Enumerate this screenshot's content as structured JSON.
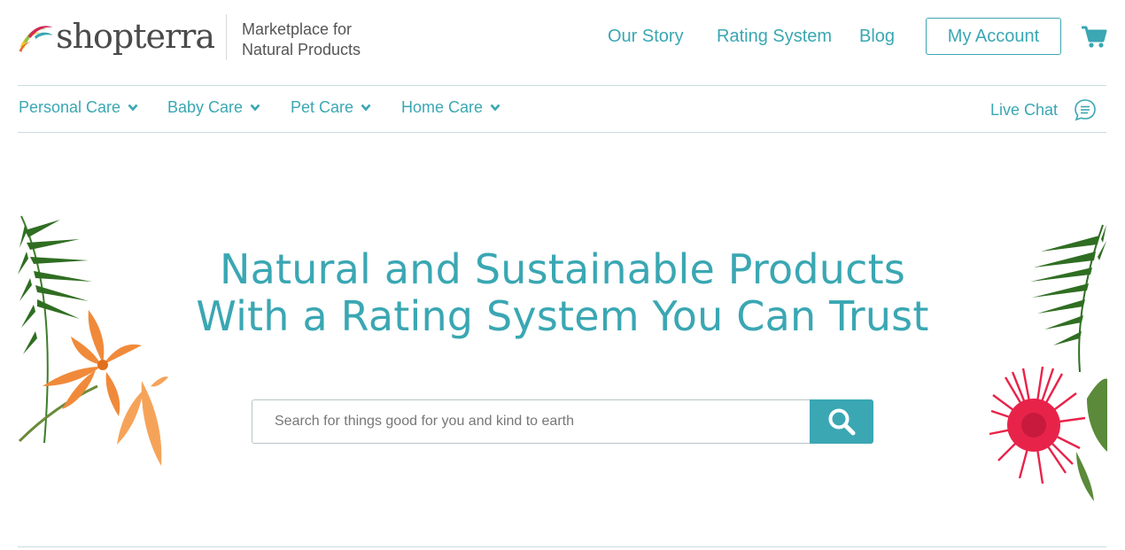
{
  "brand": {
    "name": "shopterra",
    "tagline_line1": "Marketplace for",
    "tagline_line2": "Natural Products"
  },
  "top_nav": {
    "our_story": "Our Story",
    "rating_system": "Rating System",
    "blog": "Blog",
    "my_account": "My Account",
    "cart_icon": "shopping-cart-icon"
  },
  "categories": [
    {
      "label": "Personal Care",
      "icon": "chevron-down-icon"
    },
    {
      "label": "Baby Care",
      "icon": "chevron-down-icon"
    },
    {
      "label": "Pet Care",
      "icon": "chevron-down-icon"
    },
    {
      "label": "Home Care",
      "icon": "chevron-down-icon"
    }
  ],
  "live_chat": {
    "label": "Live Chat",
    "icon": "chat-bubble-icon"
  },
  "hero": {
    "line1": "Natural and Sustainable Products",
    "line2": "With a Rating System You Can Trust"
  },
  "search": {
    "placeholder": "Search for things good for you and kind to earth",
    "value": "",
    "icon": "search-icon"
  },
  "colors": {
    "accent": "#3aa7b3",
    "text_dark": "#4a4a4a",
    "divider": "#c9dcdf"
  }
}
